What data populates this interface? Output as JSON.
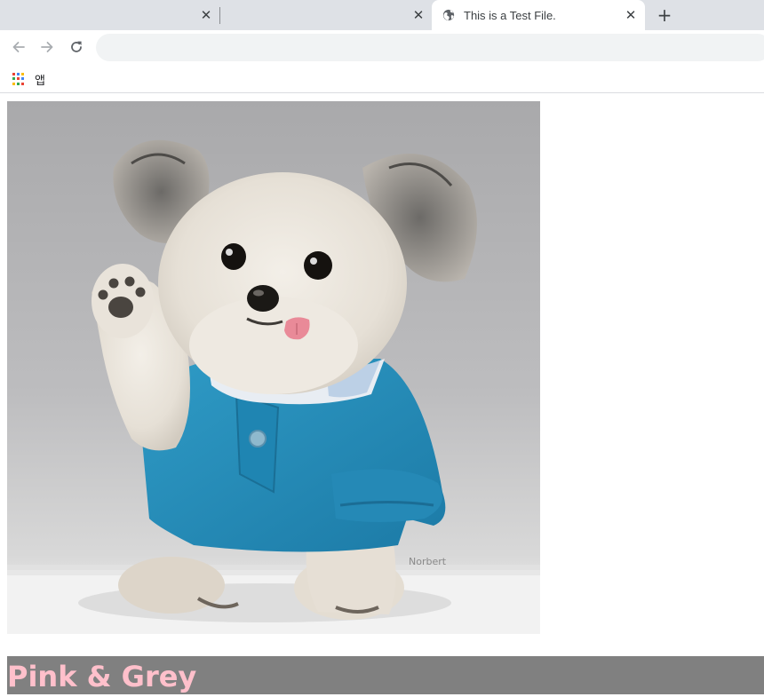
{
  "browser": {
    "tabs": [
      {
        "title": "",
        "close_glyph": "✕",
        "active": false
      },
      {
        "title": "",
        "close_glyph": "✕",
        "active": false
      },
      {
        "title": "This is a Test File.",
        "close_glyph": "✕",
        "active": true,
        "favicon": "globe-icon"
      }
    ],
    "new_tab_glyph": "+",
    "toolbar": {
      "back_icon": "arrow-left-icon",
      "forward_icon": "arrow-right-icon",
      "reload_icon": "reload-icon",
      "address_value": "",
      "address_placeholder": ""
    },
    "bookmarks_bar": {
      "apps_icon": "apps-grid-icon",
      "apps_label": "앱"
    }
  },
  "page": {
    "image": {
      "subject": "dog-photo",
      "watermark": "Norbert"
    },
    "banner": {
      "heading": "Pink & Grey",
      "background_color": "#808080",
      "text_color": "#ffc0cb"
    }
  },
  "colors": {
    "tabstrip": "#dee1e6",
    "omnibox": "#f1f3f4",
    "apps_grid": [
      "#ea4335",
      "#4285f4",
      "#fbbc05",
      "#34a853",
      "#ea4335",
      "#4285f4",
      "#fbbc05",
      "#34a853",
      "#ea4335"
    ]
  }
}
